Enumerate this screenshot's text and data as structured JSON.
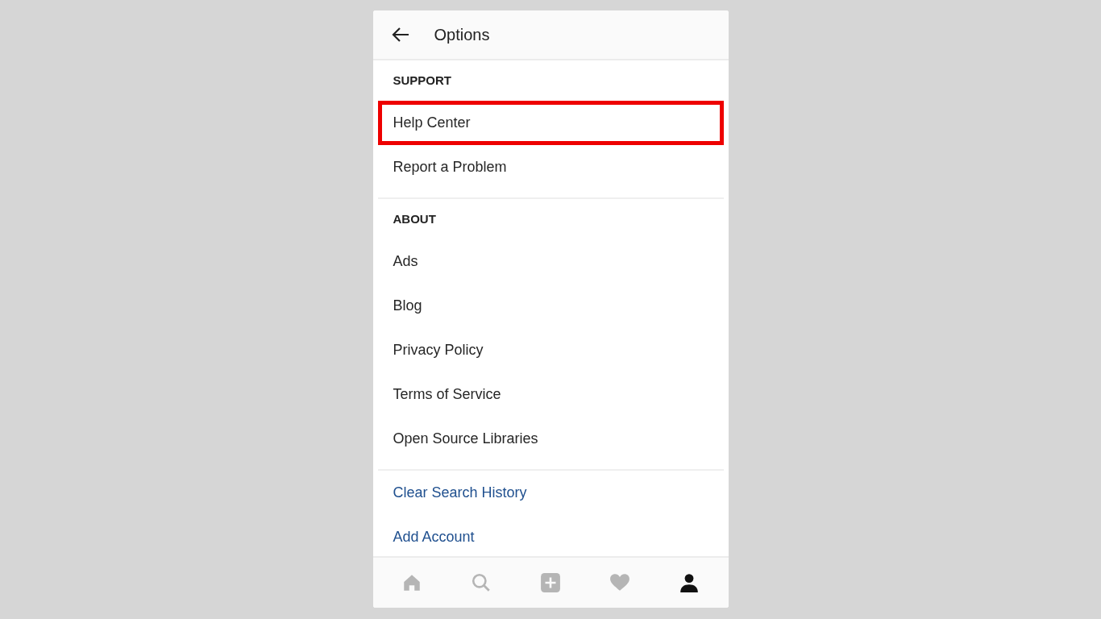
{
  "header": {
    "title": "Options"
  },
  "sections": [
    {
      "heading": "SUPPORT",
      "items": [
        {
          "label": "Help Center",
          "kind": "plain",
          "highlighted": true
        },
        {
          "label": "Report a Problem",
          "kind": "plain",
          "highlighted": false
        }
      ]
    },
    {
      "heading": "ABOUT",
      "items": [
        {
          "label": "Ads",
          "kind": "plain",
          "highlighted": false
        },
        {
          "label": "Blog",
          "kind": "plain",
          "highlighted": false
        },
        {
          "label": "Privacy Policy",
          "kind": "plain",
          "highlighted": false
        },
        {
          "label": "Terms of Service",
          "kind": "plain",
          "highlighted": false
        },
        {
          "label": "Open Source Libraries",
          "kind": "plain",
          "highlighted": false
        }
      ]
    },
    {
      "items": [
        {
          "label": "Clear Search History",
          "kind": "action",
          "highlighted": false
        },
        {
          "label": "Add Account",
          "kind": "action",
          "highlighted": false
        }
      ]
    }
  ],
  "bottom_nav": [
    {
      "kind": "home",
      "selected": false
    },
    {
      "kind": "search",
      "selected": false
    },
    {
      "kind": "add",
      "selected": false
    },
    {
      "kind": "heart",
      "selected": false
    },
    {
      "kind": "profile",
      "selected": true
    }
  ]
}
